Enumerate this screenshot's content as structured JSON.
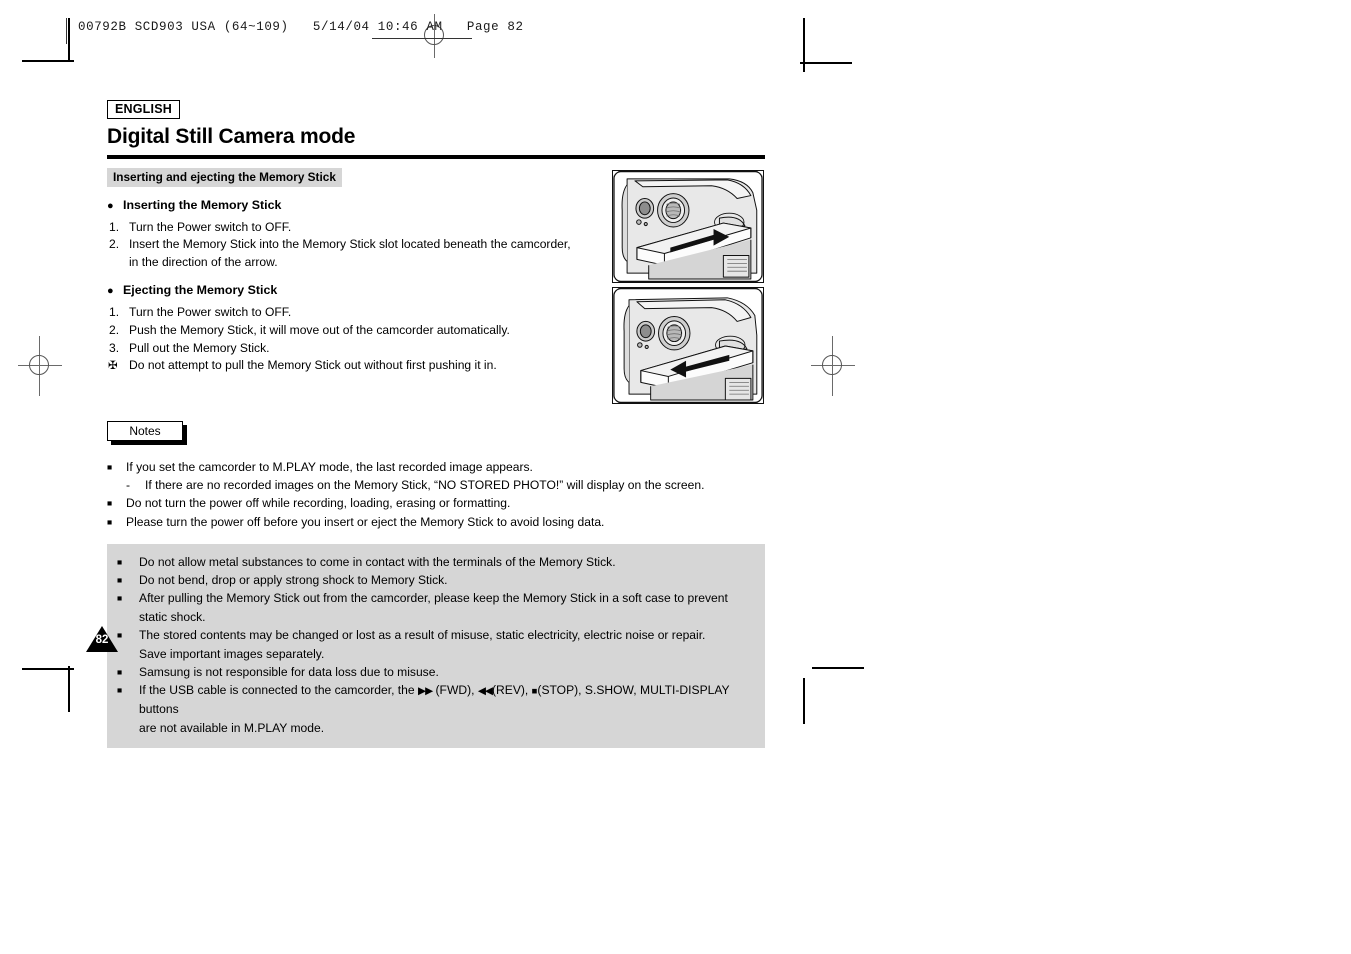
{
  "printer_slug": "00792B SCD903 USA (64~109)   5/14/04 10:46 AM   Page 82",
  "header": {
    "language_badge": "ENGLISH",
    "title": "Digital Still Camera mode",
    "section_bar": "Inserting and ejecting the Memory Stick"
  },
  "sections": [
    {
      "heading": "Inserting the Memory Stick",
      "steps": [
        {
          "num": "1.",
          "text": "Turn the Power switch to OFF.",
          "continuation": ""
        },
        {
          "num": "2.",
          "text": "Insert the Memory Stick into the Memory Stick slot located beneath the camcorder,",
          "continuation": "in the direction of the arrow."
        }
      ]
    },
    {
      "heading": "Ejecting the Memory Stick",
      "steps": [
        {
          "num": "1.",
          "text": "Turn the Power switch to OFF.",
          "continuation": ""
        },
        {
          "num": "2.",
          "text": "Push the Memory Stick, it will move out of the camcorder automatically.",
          "continuation": ""
        },
        {
          "num": "3.",
          "text": "Pull out the Memory Stick.",
          "continuation": ""
        }
      ]
    }
  ],
  "flower_note": {
    "marker": "✠",
    "text": "Do not attempt to pull the Memory Stick out without first pushing it in."
  },
  "notes": {
    "label": "Notes",
    "items": [
      "If you set the camcorder to M.PLAY mode, the last recorded image appears.",
      "Do not turn the power off while recording, loading, erasing or formatting.",
      "Please turn the power off before you insert or eject the Memory Stick to avoid losing data."
    ],
    "sub_item": {
      "dash": "-",
      "text": "If there are no recorded images on the Memory Stick, “NO STORED PHOTO!” will display on the screen."
    }
  },
  "caution_box": {
    "background_color": "#d6d6d6",
    "items": [
      {
        "text": "Do not allow metal substances to come in contact with the terminals of the Memory Stick.",
        "continuation": ""
      },
      {
        "text": "Do not bend, drop or apply strong shock to Memory Stick.",
        "continuation": ""
      },
      {
        "text": "After pulling the Memory Stick out from the camcorder, please keep the Memory Stick in a soft case to prevent static shock.",
        "continuation": ""
      },
      {
        "text": "The stored contents may be changed or lost as a result of misuse, static electricity, electric noise or repair.",
        "continuation": "Save important images separately."
      },
      {
        "text": "Samsung is not responsible for data loss due to misuse.",
        "continuation": ""
      }
    ],
    "usb_item": {
      "lead": "If the USB cable is connected to the camcorder, the",
      "fwd_glyph": "▶▶",
      "fwd_label": "(FWD),",
      "rev_glyph": "◀◀",
      "rev_label": "(REV),",
      "stop_glyph": "■",
      "stop_label": "(STOP), S.SHOW,  MULTI-DISPLAY buttons",
      "continuation": "are not available in M.PLAY mode."
    }
  },
  "figures": [
    {
      "name": "memory-stick-insert",
      "caption_direction": "in"
    },
    {
      "name": "memory-stick-eject",
      "caption_direction": "out"
    }
  ],
  "page_number": "82",
  "colors": {
    "section_bar_bg": "#d6d6d6",
    "rule": "#000000",
    "text": "#000000"
  }
}
